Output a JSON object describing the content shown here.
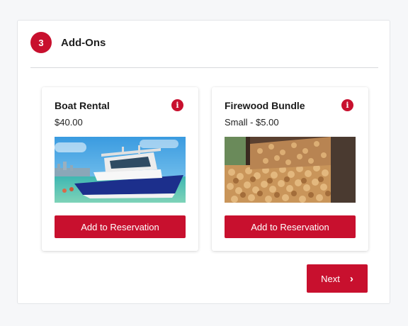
{
  "step": {
    "number": "3",
    "title": "Add-Ons"
  },
  "addons": [
    {
      "title": "Boat Rental",
      "price": "$40.00",
      "button_label": "Add to Reservation",
      "icon": "info-icon",
      "image": "boat-photo"
    },
    {
      "title": "Firewood Bundle",
      "price": "Small - $5.00",
      "button_label": "Add to Reservation",
      "icon": "info-icon",
      "image": "firewood-photo"
    }
  ],
  "footer": {
    "next_label": "Next",
    "next_icon": "chevron-right-icon"
  },
  "colors": {
    "accent": "#c8102e",
    "panel_bg": "#ffffff",
    "page_bg": "#f6f7f9"
  }
}
